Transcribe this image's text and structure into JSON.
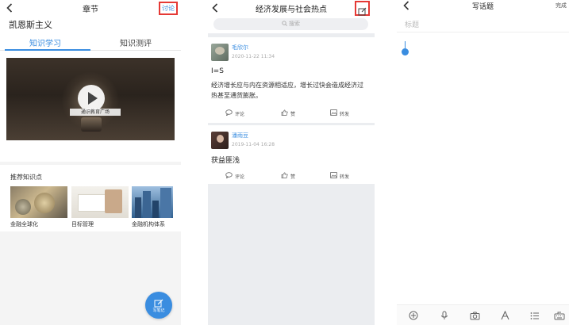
{
  "chapter_screen": {
    "nav_title": "章节",
    "discuss_label": "讨论",
    "course_title": "凯恩斯主义",
    "tabs": [
      {
        "label": "知识学习",
        "active": true
      },
      {
        "label": "知识测评",
        "active": false
      }
    ],
    "video_caption": "通识教育广场",
    "recommend_title": "推荐知识点",
    "recommend_items": [
      {
        "label": "金融全球化"
      },
      {
        "label": "目标管理"
      },
      {
        "label": "金融机构体系"
      }
    ],
    "fab_label": "写笔记"
  },
  "topic_screen": {
    "nav_title": "经济发展与社会热点",
    "search_placeholder": "搜索",
    "posts": [
      {
        "author": "毛欣尔",
        "time": "2020-11-22 11:34",
        "title": "I=S",
        "body": "经济增长应与内在资源相适应，增长过快会造成经济过热甚至通货膨胀。",
        "actions": {
          "comment": "评论",
          "like": "赞",
          "share": "转发"
        }
      },
      {
        "author": "潘雨豆",
        "time": "2019-11-04 16:28",
        "title": "获益匪浅",
        "body": "",
        "actions": {
          "comment": "评论",
          "like": "赞",
          "share": "转发"
        }
      }
    ]
  },
  "compose_screen": {
    "nav_title": "写话题",
    "done_label": "完成",
    "title_placeholder": "标题"
  },
  "colors": {
    "accent": "#3a8de0",
    "highlight_border": "#e53935",
    "page_gray": "#f4f4f4",
    "topic_gray": "#ebedf0"
  },
  "icons": {
    "back": "chevron-left-icon",
    "edit": "edit-square-icon",
    "search": "search-icon",
    "play": "play-icon",
    "comment": "comment-icon",
    "like": "thumbs-up-icon",
    "share": "share-image-icon",
    "toolbar": [
      "add-circle-icon",
      "microphone-icon",
      "camera-icon",
      "font-icon",
      "list-icon",
      "keyboard-icon"
    ]
  }
}
